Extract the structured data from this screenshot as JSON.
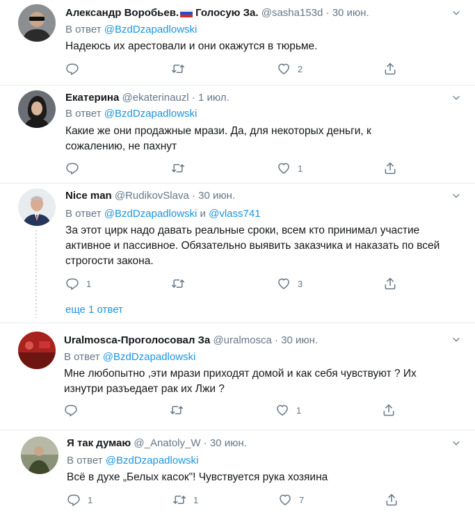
{
  "tweets": [
    {
      "name": "Александр Воробьев.",
      "name_suffix": "Голосую За.",
      "handle": "@sasha153d",
      "time": "30 июн.",
      "reply_prefix": "В ответ",
      "reply_to": "@BzdDzapadlowski",
      "text": "Надеюсь их арестовали и они окажутся в тюрьме.",
      "replies": "",
      "retweets": "",
      "likes": "2"
    },
    {
      "name": "Екатерина",
      "handle": "@ekaterinauzl",
      "time": "1 июл.",
      "reply_prefix": "В ответ",
      "reply_to": "@BzdDzapadlowski",
      "text": "Какие же они продажные мрази. Да, для некоторых деньги, к сожалению, не пахнут",
      "replies": "",
      "retweets": "",
      "likes": "1"
    },
    {
      "name": "Nice man",
      "handle": "@RudikovSlava",
      "time": "30 июн.",
      "reply_prefix": "В ответ",
      "reply_to": "@BzdDzapadlowski",
      "reply_and": "и",
      "reply_to_2": "@vlass741",
      "text": "За этот цирк надо давать реальные сроки, всем кто принимал участие активное и пассивное. Обязательно выявить заказчика и наказать по всей строгости закона.",
      "replies": "1",
      "retweets": "",
      "likes": "3"
    },
    {
      "name": "Uralmosca-Проголосовал За",
      "handle": "@uralmosca",
      "time": "30 июн.",
      "reply_prefix": "В ответ",
      "reply_to": "@BzdDzapadlowski",
      "text": "Мне любопытно ,эти мрази приходят домой и как себя чувствуют ? Их изнутри разъедает рак их Лжи ?",
      "replies": "",
      "retweets": "",
      "likes": "1"
    },
    {
      "name": "Я так думаю",
      "handle": "@_Anatoly_W",
      "time": "30 июн.",
      "reply_prefix": "В ответ",
      "reply_to": "@BzdDzapadlowski",
      "text": "Всё в духе „Белых касок\"! Чувствуется рука хозяина",
      "replies": "1",
      "retweets": "1",
      "likes": "7"
    }
  ],
  "show_more": "еще 1 ответ",
  "colors": {
    "link": "#1b95e0",
    "muted": "#657786",
    "divider": "#e6ecf0"
  },
  "icons": [
    "reply-icon",
    "retweet-icon",
    "like-icon",
    "share-icon",
    "chevron-down-icon",
    "flag-icon"
  ]
}
